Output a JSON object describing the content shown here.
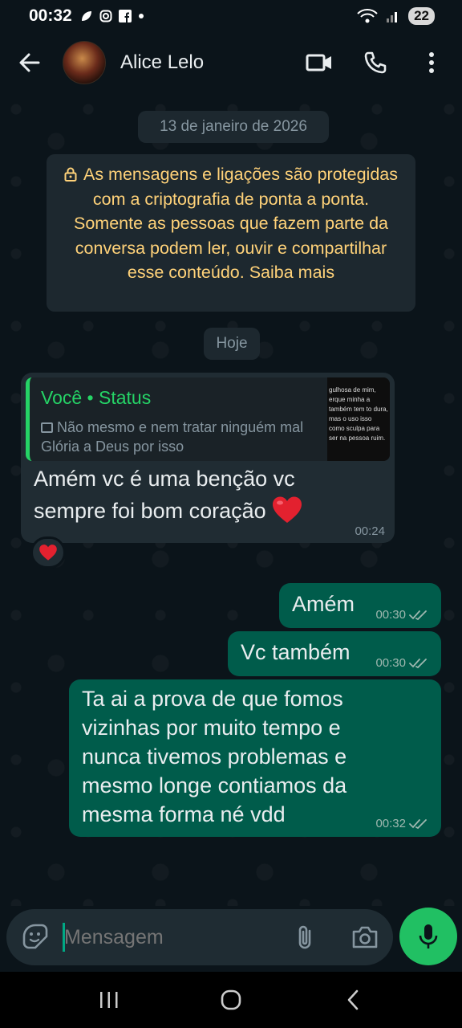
{
  "status_bar": {
    "time": "00:32",
    "icons": [
      "leaf-icon",
      "instagram-icon",
      "facebook-icon",
      "dot-icon"
    ],
    "battery": "22"
  },
  "header": {
    "contact_name": "Alice Lelo",
    "icons": [
      "back-arrow-icon",
      "video-call-icon",
      "phone-icon",
      "more-vert-icon"
    ]
  },
  "chat": {
    "date_label": "13 de janeiro de 2026",
    "encryption_notice": "As mensagens e ligações são protegidas com a criptografia de ponta a ponta. Somente as pessoas que fazem parte da conversa podem ler, ouvir e compartilhar esse conteúdo. Saiba mais",
    "today_label": "Hoje",
    "incoming": {
      "reply_to_name": "Você • Status",
      "reply_to_text": "Não mesmo e nem tratar ninguém mal Glória a Deus por isso",
      "reply_thumb_text": "gulhosa de mim, erque minha a também tem to dura, mas o uso isso como sculpa para ser na pessoa ruim.",
      "text": "Amém vc é uma benção vc sempre foi bom coração",
      "time": "00:24",
      "reaction": "❤"
    },
    "outgoing": [
      {
        "text": "Amém",
        "time": "00:30"
      },
      {
        "text": "Vc também",
        "time": "00:30"
      },
      {
        "text": "Ta ai a prova de que fomos vizinhas por muito tempo e nunca tivemos problemas e mesmo longe contiamos da mesma forma né vdd",
        "time": "00:32"
      }
    ]
  },
  "input": {
    "placeholder": "Mensagem"
  },
  "colors": {
    "background": "#0b141a",
    "incoming_bubble": "#202c33",
    "outgoing_bubble": "#005c4b",
    "accent": "#21c063",
    "system_text": "#ffd279"
  }
}
